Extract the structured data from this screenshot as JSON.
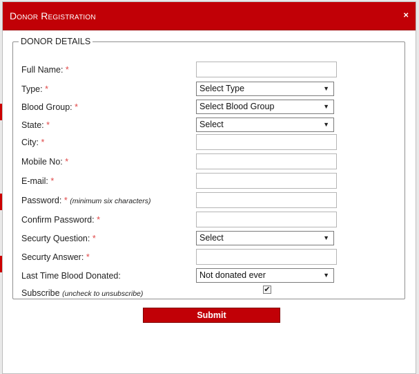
{
  "modal": {
    "title": "Donor Registration",
    "close": "×"
  },
  "fieldset": {
    "legend": "DONOR DETAILS"
  },
  "fields": {
    "full_name": {
      "label": "Full Name:",
      "required": "*",
      "value": ""
    },
    "type": {
      "label": "Type:",
      "required": "*",
      "selected": "Select Type"
    },
    "blood_group": {
      "label": "Blood Group:",
      "required": "*",
      "selected": "Select Blood Group"
    },
    "state": {
      "label": "State:",
      "required": "*",
      "selected": "Select"
    },
    "city": {
      "label": "City:",
      "required": "*",
      "value": ""
    },
    "mobile": {
      "label": "Mobile No:",
      "required": "*",
      "value": ""
    },
    "email": {
      "label": "E-mail:",
      "required": "*",
      "value": ""
    },
    "password": {
      "label": "Password:",
      "required": "*",
      "hint": "(minimum six characters)",
      "value": ""
    },
    "confirm_password": {
      "label": "Confirm Password:",
      "required": "*",
      "value": ""
    },
    "security_question": {
      "label": "Securty Question:",
      "required": "*",
      "selected": "Select"
    },
    "security_answer": {
      "label": "Securty Answer:",
      "required": "*",
      "value": ""
    },
    "last_donated": {
      "label": "Last Time Blood Donated:",
      "selected": "Not donated ever"
    },
    "subscribe": {
      "label": "Subscribe",
      "hint": "(uncheck to unsubscribe)",
      "checked": true,
      "mark": "✔"
    }
  },
  "submit_label": "Submit",
  "icons": {
    "close": "close-icon",
    "caret": "chevron-down-icon",
    "check": "check-icon"
  },
  "colors": {
    "accent": "#c10006",
    "required": "#e04848"
  }
}
